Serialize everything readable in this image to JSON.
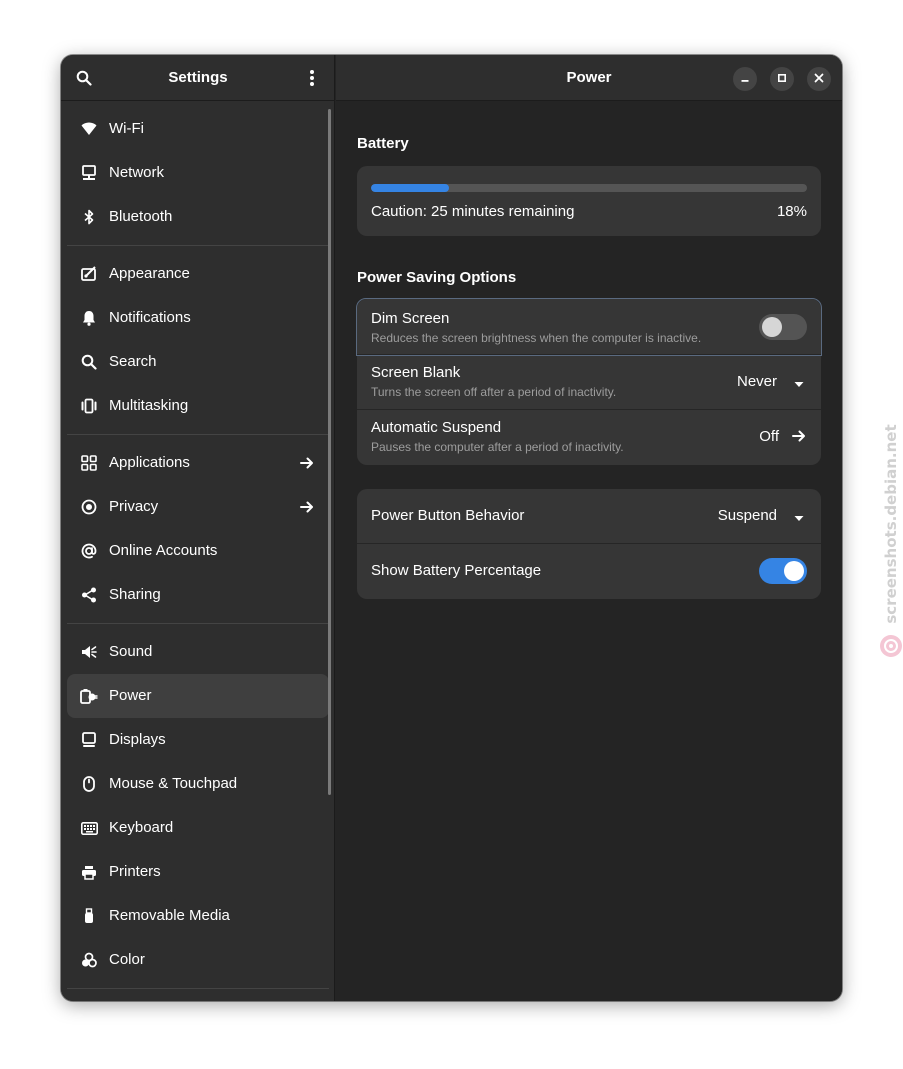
{
  "sidebar": {
    "title": "Settings",
    "items": [
      {
        "label": "Wi-Fi",
        "icon": "wifi-icon"
      },
      {
        "label": "Network",
        "icon": "network-icon"
      },
      {
        "label": "Bluetooth",
        "icon": "bluetooth-icon"
      },
      {
        "label": "Appearance",
        "icon": "appearance-icon"
      },
      {
        "label": "Notifications",
        "icon": "bell-icon"
      },
      {
        "label": "Search",
        "icon": "search-icon"
      },
      {
        "label": "Multitasking",
        "icon": "multitasking-icon"
      },
      {
        "label": "Applications",
        "icon": "applications-icon"
      },
      {
        "label": "Privacy",
        "icon": "privacy-icon"
      },
      {
        "label": "Online Accounts",
        "icon": "at-sign-icon"
      },
      {
        "label": "Sharing",
        "icon": "share-icon"
      },
      {
        "label": "Sound",
        "icon": "speaker-icon"
      },
      {
        "label": "Power",
        "icon": "power-plug-icon"
      },
      {
        "label": "Displays",
        "icon": "display-icon"
      },
      {
        "label": "Mouse & Touchpad",
        "icon": "mouse-icon"
      },
      {
        "label": "Keyboard",
        "icon": "keyboard-icon"
      },
      {
        "label": "Printers",
        "icon": "printer-icon"
      },
      {
        "label": "Removable Media",
        "icon": "usb-icon"
      },
      {
        "label": "Color",
        "icon": "color-icon"
      }
    ],
    "active": "Power"
  },
  "main": {
    "title": "Power",
    "battery": {
      "section_title": "Battery",
      "status": "Caution: 25 minutes remaining",
      "percent_label": "18%",
      "level_fraction": 0.18
    },
    "power_saving": {
      "section_title": "Power Saving Options",
      "dim_screen": {
        "title": "Dim Screen",
        "subtitle": "Reduces the screen brightness when the computer is inactive.",
        "enabled": false
      },
      "screen_blank": {
        "title": "Screen Blank",
        "subtitle": "Turns the screen off after a period of inactivity.",
        "value": "Never"
      },
      "automatic_suspend": {
        "title": "Automatic Suspend",
        "subtitle": "Pauses the computer after a period of inactivity.",
        "value": "Off"
      }
    },
    "general": {
      "power_button": {
        "title": "Power Button Behavior",
        "value": "Suspend"
      },
      "battery_percentage": {
        "title": "Show Battery Percentage",
        "enabled": true
      }
    }
  },
  "colors": {
    "accent": "#3584e4",
    "window_bg": "#242424",
    "sidebar_bg": "#2e2e2e",
    "card_bg": "#363636"
  },
  "watermark": {
    "text": "screenshots.debian.net"
  }
}
